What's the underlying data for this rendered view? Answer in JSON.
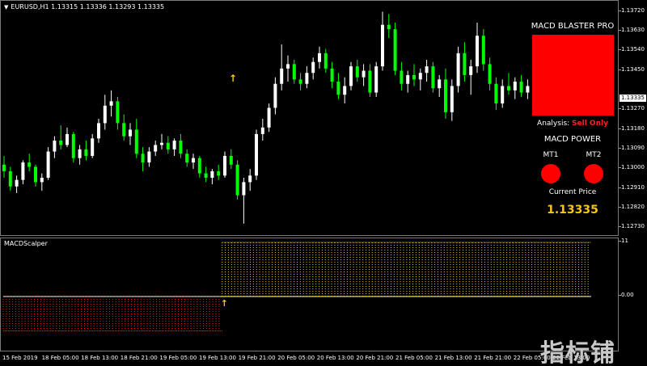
{
  "chart": {
    "title_arrow": "▼",
    "title": "EURUSD,H1  1.13315 1.13336 1.13293 1.13335",
    "price_ticks": [
      {
        "label": "1.13720",
        "price": 1.1372
      },
      {
        "label": "1.13630",
        "price": 1.1363
      },
      {
        "label": "1.13540",
        "price": 1.1354
      },
      {
        "label": "1.13450",
        "price": 1.1345
      },
      {
        "label": "1.13270",
        "price": 1.1327
      },
      {
        "label": "1.13180",
        "price": 1.1318
      },
      {
        "label": "1.13090",
        "price": 1.1309
      },
      {
        "label": "1.13000",
        "price": 1.13
      },
      {
        "label": "1.12910",
        "price": 1.1291
      },
      {
        "label": "1.12820",
        "price": 1.1282
      },
      {
        "label": "1.12730",
        "price": 1.1273
      }
    ],
    "current_price_label": "1.13335",
    "price_range": [
      1.1269,
      1.1377
    ],
    "candles": [
      [
        1.1302,
        1.1306,
        1.1296,
        1.1299
      ],
      [
        1.1299,
        1.1301,
        1.129,
        1.1292
      ],
      [
        1.1292,
        1.1297,
        1.1289,
        1.1295
      ],
      [
        1.1295,
        1.1304,
        1.1293,
        1.1303
      ],
      [
        1.1303,
        1.1307,
        1.1299,
        1.1301
      ],
      [
        1.1301,
        1.1302,
        1.1292,
        1.1294
      ],
      [
        1.1294,
        1.1298,
        1.129,
        1.1296
      ],
      [
        1.1296,
        1.131,
        1.1295,
        1.1308
      ],
      [
        1.1308,
        1.1315,
        1.1305,
        1.1313
      ],
      [
        1.1313,
        1.132,
        1.1309,
        1.1311
      ],
      [
        1.1311,
        1.1319,
        1.131,
        1.1316
      ],
      [
        1.1316,
        1.1317,
        1.1303,
        1.1305
      ],
      [
        1.1305,
        1.1311,
        1.1302,
        1.1309
      ],
      [
        1.1309,
        1.1313,
        1.1304,
        1.1306
      ],
      [
        1.1306,
        1.1316,
        1.1305,
        1.1314
      ],
      [
        1.1314,
        1.1323,
        1.1312,
        1.1321
      ],
      [
        1.1321,
        1.1334,
        1.1318,
        1.1329
      ],
      [
        1.1329,
        1.1336,
        1.1324,
        1.1331
      ],
      [
        1.1331,
        1.1333,
        1.1318,
        1.1321
      ],
      [
        1.1321,
        1.1325,
        1.1313,
        1.1315
      ],
      [
        1.1315,
        1.1321,
        1.1311,
        1.1318
      ],
      [
        1.1318,
        1.1323,
        1.1305,
        1.1307
      ],
      [
        1.1307,
        1.131,
        1.1299,
        1.1303
      ],
      [
        1.1303,
        1.131,
        1.1301,
        1.1308
      ],
      [
        1.1308,
        1.1313,
        1.1306,
        1.1311
      ],
      [
        1.1311,
        1.1316,
        1.1309,
        1.1312
      ],
      [
        1.1312,
        1.1315,
        1.1307,
        1.1309
      ],
      [
        1.1309,
        1.1314,
        1.1306,
        1.1313
      ],
      [
        1.1313,
        1.1316,
        1.1305,
        1.1307
      ],
      [
        1.1307,
        1.1309,
        1.1301,
        1.1303
      ],
      [
        1.1303,
        1.1307,
        1.13,
        1.1305
      ],
      [
        1.1305,
        1.1306,
        1.1296,
        1.1298
      ],
      [
        1.1298,
        1.1301,
        1.1294,
        1.1296
      ],
      [
        1.1296,
        1.13,
        1.1293,
        1.1299
      ],
      [
        1.1299,
        1.1302,
        1.1295,
        1.1297
      ],
      [
        1.1297,
        1.1308,
        1.1296,
        1.1306
      ],
      [
        1.1306,
        1.1309,
        1.13,
        1.1302
      ],
      [
        1.1302,
        1.1304,
        1.1286,
        1.1288
      ],
      [
        1.1288,
        1.1296,
        1.1275,
        1.1294
      ],
      [
        1.1294,
        1.13,
        1.129,
        1.1297
      ],
      [
        1.1297,
        1.1318,
        1.1295,
        1.1316
      ],
      [
        1.1316,
        1.1323,
        1.1313,
        1.1319
      ],
      [
        1.1319,
        1.133,
        1.1317,
        1.1328
      ],
      [
        1.1328,
        1.1342,
        1.1325,
        1.1339
      ],
      [
        1.1339,
        1.1357,
        1.1336,
        1.1346
      ],
      [
        1.1346,
        1.1352,
        1.134,
        1.1348
      ],
      [
        1.1348,
        1.135,
        1.1339,
        1.1341
      ],
      [
        1.1341,
        1.1344,
        1.1336,
        1.1339
      ],
      [
        1.1339,
        1.1347,
        1.1337,
        1.1344
      ],
      [
        1.1344,
        1.1351,
        1.1341,
        1.1349
      ],
      [
        1.1349,
        1.1356,
        1.1346,
        1.1353
      ],
      [
        1.1353,
        1.1355,
        1.1344,
        1.1346
      ],
      [
        1.1346,
        1.1349,
        1.1337,
        1.134
      ],
      [
        1.134,
        1.1344,
        1.1332,
        1.1334
      ],
      [
        1.1334,
        1.1342,
        1.133,
        1.1338
      ],
      [
        1.1338,
        1.1349,
        1.1336,
        1.1347
      ],
      [
        1.1347,
        1.135,
        1.134,
        1.1342
      ],
      [
        1.1342,
        1.1348,
        1.1338,
        1.1345
      ],
      [
        1.1345,
        1.1348,
        1.1333,
        1.1335
      ],
      [
        1.1335,
        1.1349,
        1.1333,
        1.1347
      ],
      [
        1.1347,
        1.1372,
        1.1345,
        1.1366
      ],
      [
        1.1366,
        1.1371,
        1.136,
        1.1364
      ],
      [
        1.1364,
        1.1367,
        1.1343,
        1.1345
      ],
      [
        1.1345,
        1.1349,
        1.1336,
        1.1339
      ],
      [
        1.1339,
        1.1345,
        1.1335,
        1.1343
      ],
      [
        1.1343,
        1.1348,
        1.1338,
        1.1341
      ],
      [
        1.1341,
        1.1346,
        1.1336,
        1.1344
      ],
      [
        1.1344,
        1.135,
        1.134,
        1.1347
      ],
      [
        1.1347,
        1.1349,
        1.1335,
        1.1337
      ],
      [
        1.1337,
        1.1343,
        1.1333,
        1.1341
      ],
      [
        1.1341,
        1.1346,
        1.1323,
        1.1326
      ],
      [
        1.1326,
        1.1341,
        1.1322,
        1.1338
      ],
      [
        1.1338,
        1.1356,
        1.1335,
        1.1353
      ],
      [
        1.1353,
        1.1358,
        1.134,
        1.1343
      ],
      [
        1.1343,
        1.135,
        1.1334,
        1.1347
      ],
      [
        1.1347,
        1.1367,
        1.1344,
        1.1361
      ],
      [
        1.1361,
        1.1364,
        1.1345,
        1.1348
      ],
      [
        1.1348,
        1.1351,
        1.1336,
        1.1339
      ],
      [
        1.1339,
        1.1342,
        1.1327,
        1.133
      ],
      [
        1.133,
        1.1341,
        1.1328,
        1.1338
      ],
      [
        1.1338,
        1.1344,
        1.1334,
        1.1336
      ],
      [
        1.1336,
        1.1342,
        1.1332,
        1.134
      ],
      [
        1.134,
        1.1343,
        1.1333,
        1.1335
      ],
      [
        1.1335,
        1.1341,
        1.1332,
        1.1338
      ],
      [
        1.1338,
        1.1341,
        1.1333,
        1.1335
      ],
      [
        1.1335,
        1.1345,
        1.1333,
        1.1336
      ]
    ]
  },
  "indicator": {
    "name": "MACDScalper",
    "axis_top": "11",
    "axis_zero": "0.00",
    "range": [
      -11,
      11
    ],
    "bars": [
      -7,
      -7,
      -7,
      -7,
      -7,
      -7,
      -7,
      -7,
      -7,
      -7,
      -7,
      -7,
      -7,
      -7,
      -7,
      -7,
      -7,
      -7,
      -7,
      -7,
      -7,
      -7,
      -7,
      -7,
      -7,
      -7,
      -7,
      -7,
      -7,
      -7,
      -7,
      -7,
      -7,
      -7,
      -7,
      -7,
      -7,
      -7,
      -7,
      -7,
      -7,
      -7,
      -7,
      -7,
      -7,
      -7,
      -7,
      -7,
      -7,
      -7,
      -7,
      -7,
      -7,
      -7,
      -7,
      -7,
      -7,
      -7,
      -7,
      -7,
      -7,
      -7,
      -7,
      -7,
      -7,
      -7,
      -7,
      -7,
      -7,
      -7,
      11,
      11,
      11,
      11,
      11,
      11,
      11,
      11,
      11,
      11,
      11,
      11,
      11,
      11,
      11,
      11,
      11,
      11,
      11,
      11,
      11,
      11,
      11,
      11,
      11,
      11,
      11,
      11,
      11,
      11,
      11,
      11,
      11,
      11,
      11,
      11,
      11,
      11,
      11,
      11,
      11,
      11,
      11,
      11,
      11,
      11,
      11,
      11,
      11,
      11,
      11,
      11,
      11,
      11,
      11,
      11,
      11,
      11,
      11,
      11,
      11,
      11,
      11,
      11,
      11,
      11,
      11,
      11,
      11,
      11,
      11,
      11,
      11,
      11,
      11,
      11,
      11,
      11,
      11,
      11,
      11,
      11,
      11,
      11,
      11,
      11,
      11,
      11,
      11,
      11,
      11,
      11,
      11,
      11,
      11,
      11,
      11,
      11,
      11,
      11,
      11,
      11,
      11,
      11,
      11,
      11,
      11,
      11,
      11,
      11,
      11,
      11,
      11,
      11,
      11,
      11,
      11,
      11
    ],
    "colors": {
      "negative": "#ff1a1a",
      "positive": "#f5c518",
      "zero_line": "#ffffff"
    }
  },
  "time_labels": [
    "15 Feb 2019",
    "18 Feb 05:00",
    "18 Feb 13:00",
    "18 Feb 21:00",
    "19 Feb 05:00",
    "19 Feb 13:00",
    "19 Feb 21:00",
    "20 Feb 05:00",
    "20 Feb 13:00",
    "20 Feb 21:00",
    "21 Feb 05:00",
    "21 Feb 13:00",
    "21 Feb 21:00",
    "22 Feb 05:00",
    "22 Feb 13:00"
  ],
  "panel": {
    "title": "MACD BLASTER PRO",
    "signal_color": "#ff0000",
    "analysis_label": "Analysis:",
    "analysis_value": "Sell Only",
    "power_title": "MACD POWER",
    "mt1_label": "MT1",
    "mt2_label": "MT2",
    "current_price_label": "Current Price",
    "current_price_value": "1.13335"
  },
  "watermark": "指标铺",
  "colors": {
    "bull": "#ffffff",
    "bear": "#00ff00",
    "arrow": "#f5c518",
    "background": "#000000"
  }
}
